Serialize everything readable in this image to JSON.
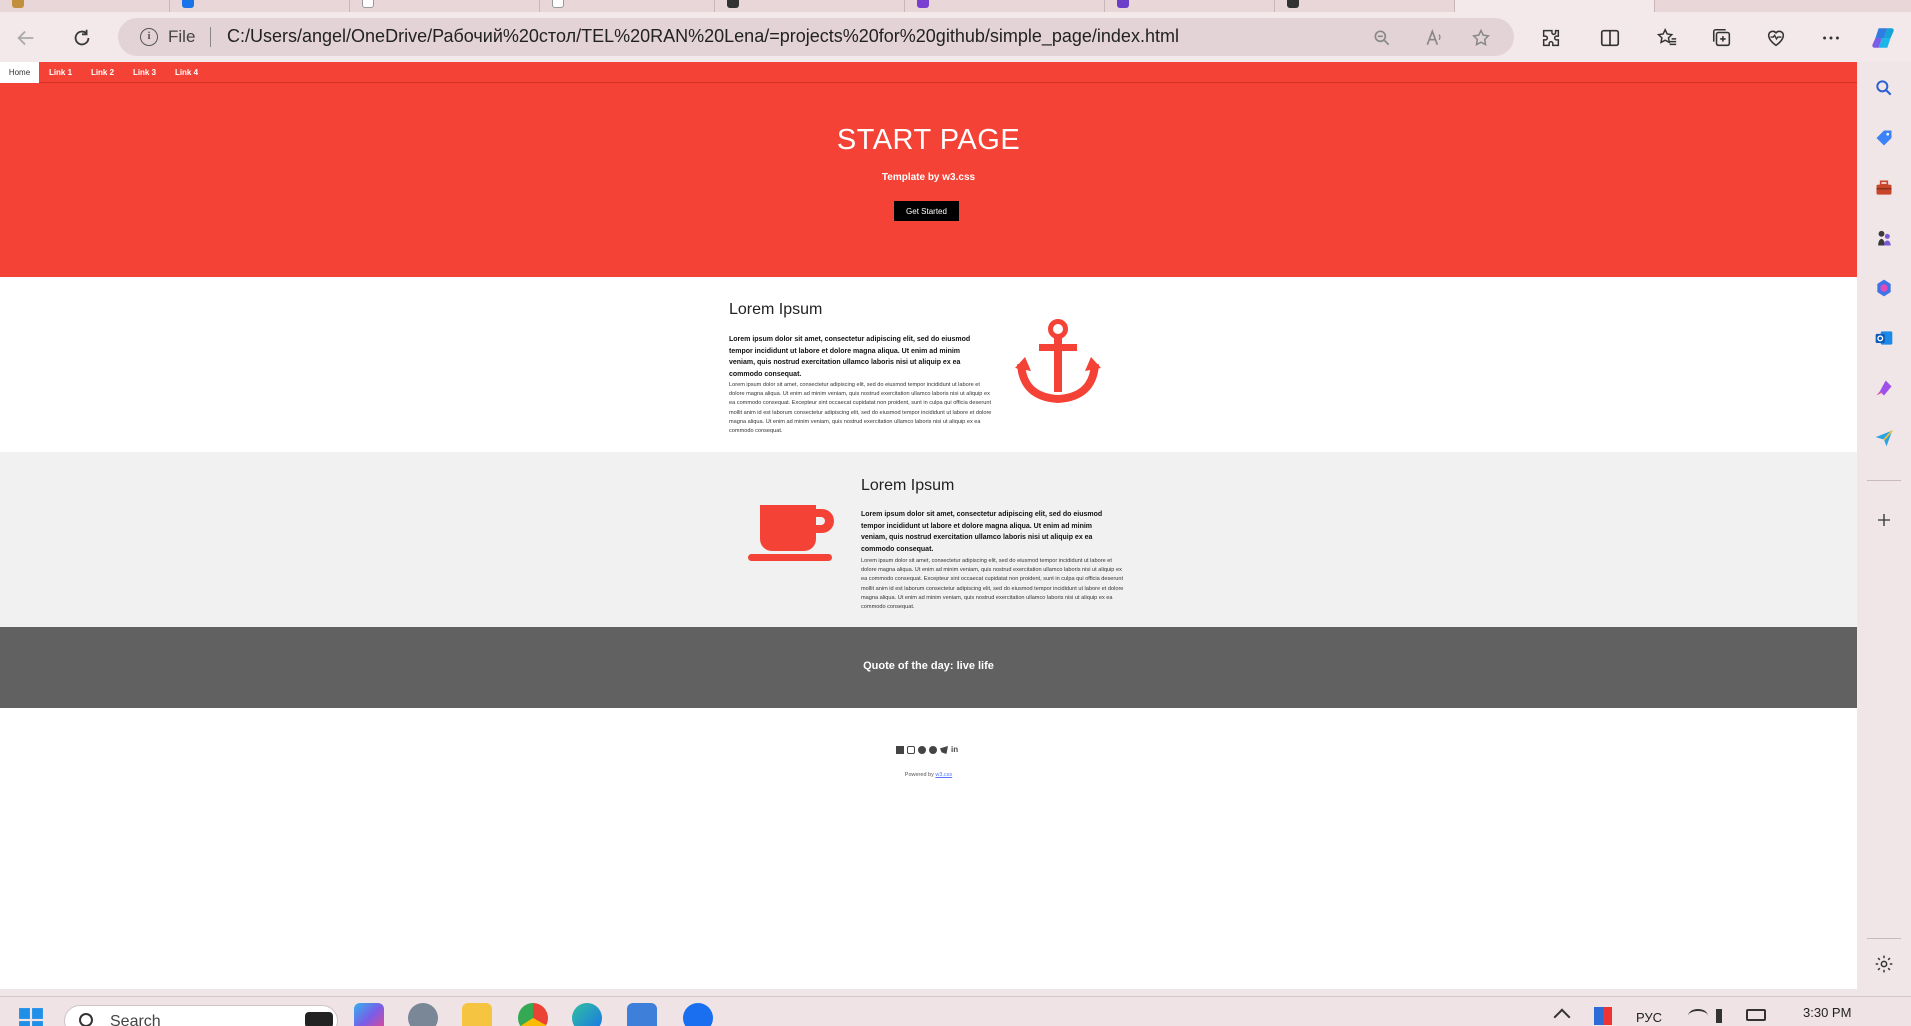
{
  "browser": {
    "address": {
      "protocol_label": "File",
      "url": "C:/Users/angel/OneDrive/Рабочий%20стол/TEL%20RAN%20Lena/=projects%20for%20github/simple_page/index.html"
    }
  },
  "page": {
    "nav": [
      "Home",
      "Link 1",
      "Link 2",
      "Link 3",
      "Link 4"
    ],
    "hero": {
      "title": "START PAGE",
      "subtitle": "Template by w3.css",
      "button_label": "Get Started"
    },
    "section1": {
      "heading": "Lorem Ipsum",
      "lead": "Lorem ipsum dolor sit amet, consectetur adipiscing elit, sed do eiusmod tempor incididunt ut labore et dolore magna aliqua. Ut enim ad minim veniam, quis nostrud exercitation ullamco laboris nisi ut aliquip ex ea commodo consequat.",
      "body": "Lorem ipsum dolor sit amet, consectetur adipiscing elit, sed do eiusmod tempor incididunt ut labore et dolore magna aliqua. Ut enim ad minim veniam, quis nostrud exercitation ullamco laboris nisi ut aliquip ex ea commodo consequat. Excepteur sint occaecat cupidatat non proident, sunt in culpa qui officia deserunt mollit anim id est laborum consectetur adipiscing elit, sed do eiusmod tempor incididunt ut labore et dolore magna aliqua. Ut enim ad minim veniam, quis nostrud exercitation ullamco laboris nisi ut aliquip ex ea commodo consequat.",
      "icon": "anchor-icon"
    },
    "section2": {
      "heading": "Lorem Ipsum",
      "lead": "Lorem ipsum dolor sit amet, consectetur adipiscing elit, sed do eiusmod tempor incididunt ut labore et dolore magna aliqua. Ut enim ad minim veniam, quis nostrud exercitation ullamco laboris nisi ut aliquip ex ea commodo consequat.",
      "body": "Lorem ipsum dolor sit amet, consectetur adipiscing elit, sed do eiusmod tempor incididunt ut labore et dolore magna aliqua. Ut enim ad minim veniam, quis nostrud exercitation ullamco laboris nisi ut aliquip ex ea commodo consequat. Excepteur sint occaecat cupidatat non proident, sunt in culpa qui officia deserunt mollit anim id est laborum consectetur adipiscing elit, sed do eiusmod tempor incididunt ut labore et dolore magna aliqua. Ut enim ad minim veniam, quis nostrud exercitation ullamco laboris nisi ut aliquip ex ea commodo consequat.",
      "icon": "coffee-icon"
    },
    "quote": "Quote of the day: live life",
    "footer": {
      "social_icons": [
        "facebook-icon",
        "instagram-icon",
        "snapchat-icon",
        "pinterest-icon",
        "twitter-icon",
        "linkedin-icon"
      ],
      "powered_prefix": "Powered by",
      "powered_link": "w3.css"
    }
  },
  "taskbar": {
    "search_placeholder": "Search",
    "language": "РУС",
    "time": "3:30 PM"
  },
  "colors": {
    "accent": "#f44336",
    "quote_bg": "#616161",
    "section_alt_bg": "#f1f1f1"
  }
}
